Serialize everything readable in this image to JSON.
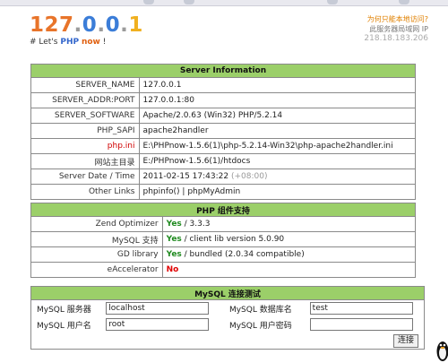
{
  "logo": {
    "text": "127.0.0.1"
  },
  "tagline": {
    "prefix": "# Let's ",
    "php": "PHP",
    "now": "now",
    "suffix": " !"
  },
  "rightinfo": {
    "link": "为何只能本地访问?",
    "label": "此服务器局域网 IP",
    "ip": "218.18.183.206"
  },
  "server_info": {
    "title": "Server Information",
    "rows": [
      {
        "key": "SERVER_NAME",
        "value": "127.0.0.1"
      },
      {
        "key": "SERVER_ADDR:PORT",
        "value": "127.0.0.1:80"
      },
      {
        "key": "SERVER_SOFTWARE",
        "value": "Apache/2.0.63 (Win32) PHP/5.2.14"
      },
      {
        "key": "PHP_SAPI",
        "value": "apache2handler"
      },
      {
        "key": "php.ini",
        "value": "E:\\PHPnow-1.5.6(1)\\php-5.2.14-Win32\\php-apache2handler.ini"
      },
      {
        "key": "网站主目录",
        "value": "E:/PHPnow-1.5.6(1)/htdocs"
      },
      {
        "key": "Server Date / Time",
        "value": "2011-02-15 17:43:22",
        "extra": "(+08:00)"
      },
      {
        "key": "Other Links",
        "link1": "phpinfo()",
        "sep": " | ",
        "link2": "phpMyAdmin"
      }
    ]
  },
  "php_components": {
    "title": "PHP 组件支持",
    "rows": [
      {
        "key": "Zend Optimizer",
        "status": "Yes",
        "detail": " / 3.3.3"
      },
      {
        "key": "MySQL 支持",
        "status": "Yes",
        "detail": " / client lib version 5.0.90"
      },
      {
        "key": "GD library",
        "status": "Yes",
        "detail": " / bundled (2.0.34 compatible)"
      },
      {
        "key": "eAccelerator",
        "status": "No",
        "detail": ""
      }
    ]
  },
  "mysql_test": {
    "title": "MySQL 连接测试",
    "server_label": "MySQL 服务器",
    "server_value": "localhost",
    "dbname_label": "MySQL 数据库名",
    "dbname_value": "test",
    "user_label": "MySQL 用户名",
    "user_value": "root",
    "password_label": "MySQL 用户密码",
    "password_value": "",
    "connect_button": "连接"
  },
  "colors": {
    "header_bg": "#9bcf69",
    "yes": "#1f8a1f",
    "no": "#e00000",
    "accent_orange": "#e08000"
  },
  "logo_colors": [
    "#e8742a",
    "#e8742a",
    "#e8742a",
    "#9b9b9b",
    "#3b7dd8",
    "#9b9b9b",
    "#3b7dd8",
    "#9b9b9b",
    "#f0b020"
  ]
}
